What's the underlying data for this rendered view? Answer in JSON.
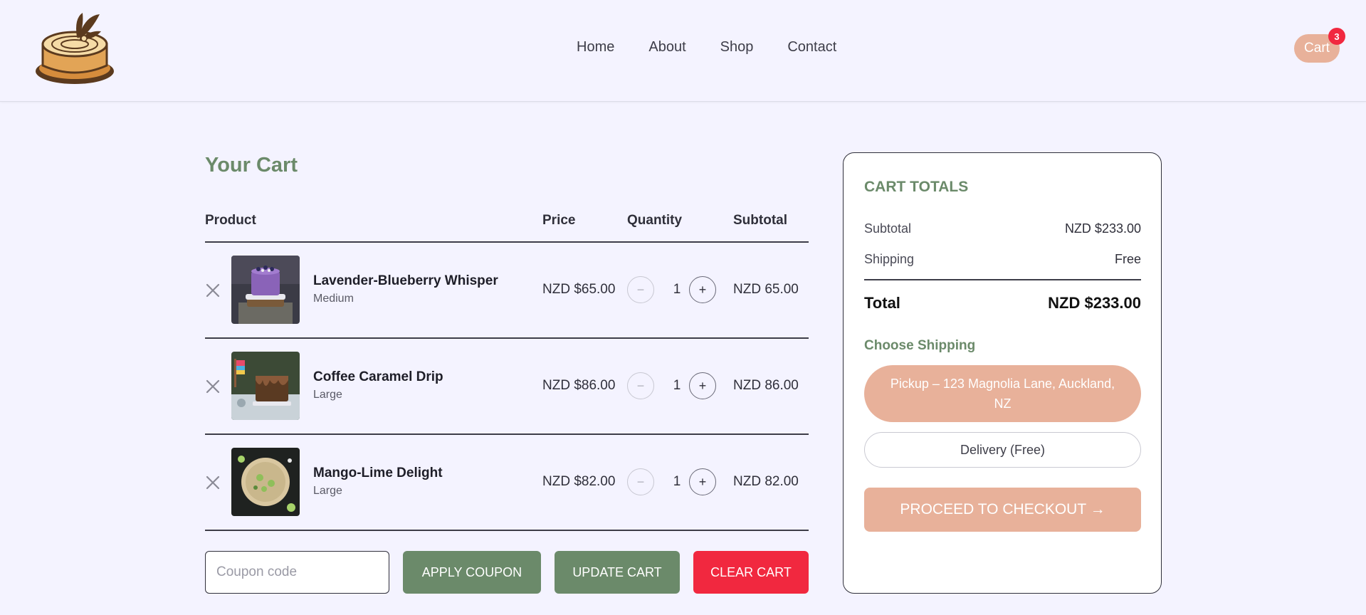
{
  "header": {
    "nav": [
      "Home",
      "About",
      "Shop",
      "Contact"
    ],
    "cart_label": "Cart",
    "cart_count": "3"
  },
  "cart": {
    "title": "Your Cart",
    "columns": {
      "product": "Product",
      "price": "Price",
      "quantity": "Quantity",
      "subtotal": "Subtotal"
    },
    "items": [
      {
        "name": "Lavender-Blueberry Whisper",
        "size": "Medium",
        "price": "NZD $65.00",
        "quantity": "1",
        "subtotal": "NZD 65.00",
        "image": "purple-cake"
      },
      {
        "name": "Coffee Caramel Drip",
        "size": "Large",
        "price": "NZD $86.00",
        "quantity": "1",
        "subtotal": "NZD 86.00",
        "image": "drip-cake"
      },
      {
        "name": "Mango-Lime Delight",
        "size": "Large",
        "price": "NZD $82.00",
        "quantity": "1",
        "subtotal": "NZD 82.00",
        "image": "lime-tart"
      }
    ],
    "coupon_placeholder": "Coupon code",
    "apply_label": "APPLY COUPON",
    "update_label": "UPDATE CART",
    "clear_label": "CLEAR CART"
  },
  "totals": {
    "title": "CART TOTALS",
    "subtotal_label": "Subtotal",
    "subtotal_value": "NZD $233.00",
    "shipping_label": "Shipping",
    "shipping_value": "Free",
    "total_label": "Total",
    "total_value": "NZD $233.00",
    "choose_shipping": "Choose Shipping",
    "pickup_option": "Pickup – 123 Magnolia Lane, Auckland, NZ",
    "delivery_option": "Delivery (Free)",
    "checkout_label": "PROCEED TO CHECKOUT →"
  },
  "colors": {
    "background": "#f4f3ff",
    "sage": "#6b8a6a",
    "peach": "#e8b19a",
    "danger": "#f1283f"
  }
}
